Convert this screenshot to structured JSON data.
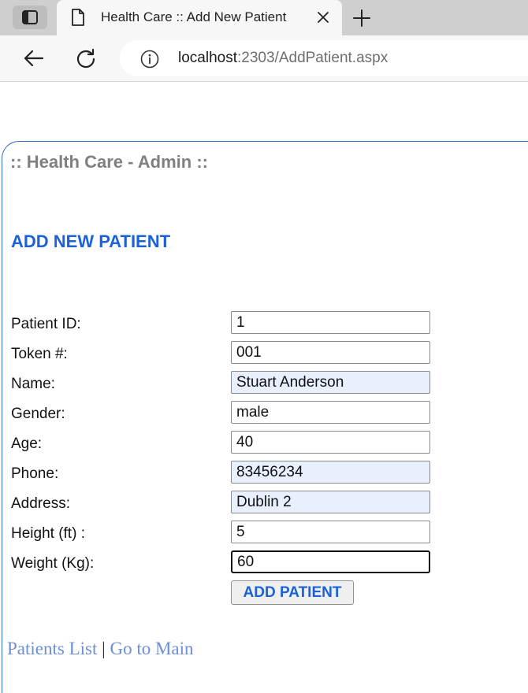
{
  "browser": {
    "tab_title": "Health Care :: Add New Patient",
    "url_host": "localhost",
    "url_rest": ":2303/AddPatient.aspx"
  },
  "header": {
    "admin_title": ":: Health Care - Admin ::",
    "page_heading": "ADD NEW PATIENT"
  },
  "form": {
    "fields": [
      {
        "label": "Patient ID:",
        "value": "1"
      },
      {
        "label": "Token #:",
        "value": "001"
      },
      {
        "label": "Name:",
        "value": "Stuart Anderson"
      },
      {
        "label": "Gender:",
        "value": "male"
      },
      {
        "label": "Age:",
        "value": "40"
      },
      {
        "label": "Phone:",
        "value": "83456234"
      },
      {
        "label": "Address:",
        "value": "Dublin 2"
      },
      {
        "label": "Height (ft) :",
        "value": "5"
      },
      {
        "label": "Weight (Kg):",
        "value": "60"
      }
    ],
    "submit_label": "ADD PATIENT"
  },
  "footer": {
    "patients_list_label": "Patients List",
    "separator": "|",
    "go_main_label": "Go to Main"
  },
  "colors": {
    "heading_blue": "#1a62d6",
    "link_blue": "#6b8fd8",
    "admin_gray": "#808080",
    "autofill_bg": "#e8f0fe"
  },
  "icons": [
    "sidebar-toggle-icon",
    "page-icon",
    "close-icon",
    "plus-icon",
    "back-arrow-icon",
    "reload-icon",
    "info-icon"
  ]
}
